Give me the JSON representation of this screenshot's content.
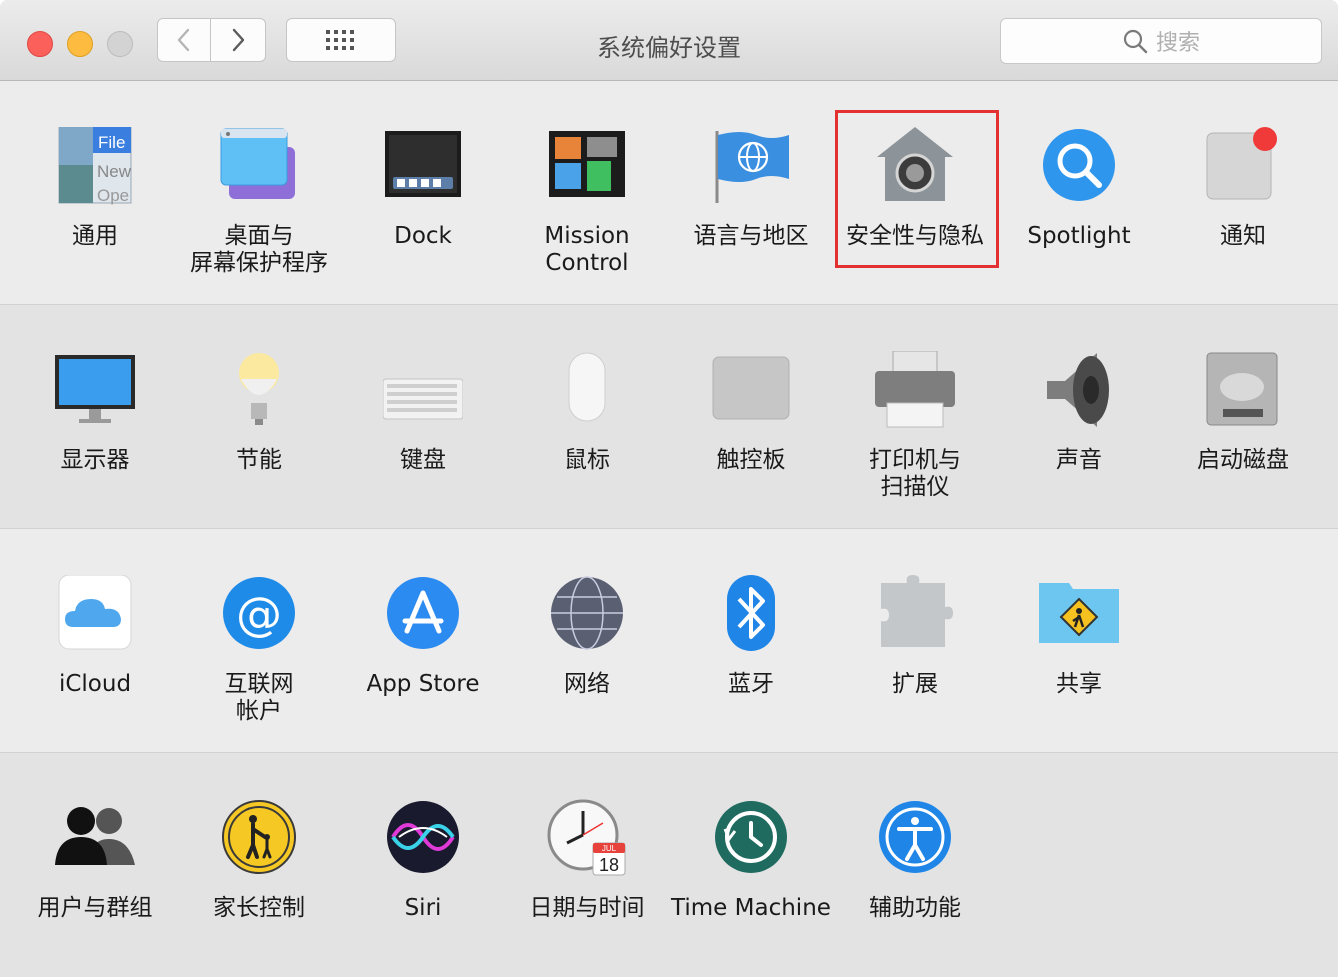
{
  "window": {
    "title": "系统偏好设置",
    "search_placeholder": "搜索"
  },
  "sections": [
    {
      "panes": [
        {
          "label": "通用",
          "icon": "general-icon"
        },
        {
          "label": "桌面与\n屏幕保护程序",
          "icon": "desktop-screensaver-icon"
        },
        {
          "label": "Dock",
          "icon": "dock-icon"
        },
        {
          "label": "Mission\nControl",
          "icon": "mission-control-icon"
        },
        {
          "label": "语言与地区",
          "icon": "language-region-icon"
        },
        {
          "label": "安全性与隐私",
          "icon": "security-privacy-icon"
        },
        {
          "label": "Spotlight",
          "icon": "spotlight-icon"
        },
        {
          "label": "通知",
          "icon": "notifications-icon"
        }
      ]
    },
    {
      "panes": [
        {
          "label": "显示器",
          "icon": "displays-icon"
        },
        {
          "label": "节能",
          "icon": "energy-saver-icon"
        },
        {
          "label": "键盘",
          "icon": "keyboard-icon"
        },
        {
          "label": "鼠标",
          "icon": "mouse-icon"
        },
        {
          "label": "触控板",
          "icon": "trackpad-icon"
        },
        {
          "label": "打印机与\n扫描仪",
          "icon": "printer-scanner-icon"
        },
        {
          "label": "声音",
          "icon": "sound-icon"
        },
        {
          "label": "启动磁盘",
          "icon": "startup-disk-icon"
        }
      ]
    },
    {
      "panes": [
        {
          "label": "iCloud",
          "icon": "icloud-icon"
        },
        {
          "label": "互联网\n帐户",
          "icon": "internet-accounts-icon"
        },
        {
          "label": "App Store",
          "icon": "app-store-icon"
        },
        {
          "label": "网络",
          "icon": "network-icon"
        },
        {
          "label": "蓝牙",
          "icon": "bluetooth-icon"
        },
        {
          "label": "扩展",
          "icon": "extensions-icon"
        },
        {
          "label": "共享",
          "icon": "sharing-icon"
        }
      ]
    },
    {
      "panes": [
        {
          "label": "用户与群组",
          "icon": "users-groups-icon"
        },
        {
          "label": "家长控制",
          "icon": "parental-controls-icon"
        },
        {
          "label": "Siri",
          "icon": "siri-icon"
        },
        {
          "label": "日期与时间",
          "icon": "date-time-icon"
        },
        {
          "label": "Time Machine",
          "icon": "time-machine-icon"
        },
        {
          "label": "辅助功能",
          "icon": "accessibility-icon"
        }
      ]
    }
  ],
  "highlighted_pane": "安全性与隐私",
  "icon_text": {
    "general": [
      "File",
      "New",
      "Ope"
    ],
    "calendar_month": "JUL",
    "calendar_day": "18"
  },
  "colors": {
    "highlight": "#e33131",
    "close": "#fc605b",
    "minimize": "#fdbc40"
  }
}
